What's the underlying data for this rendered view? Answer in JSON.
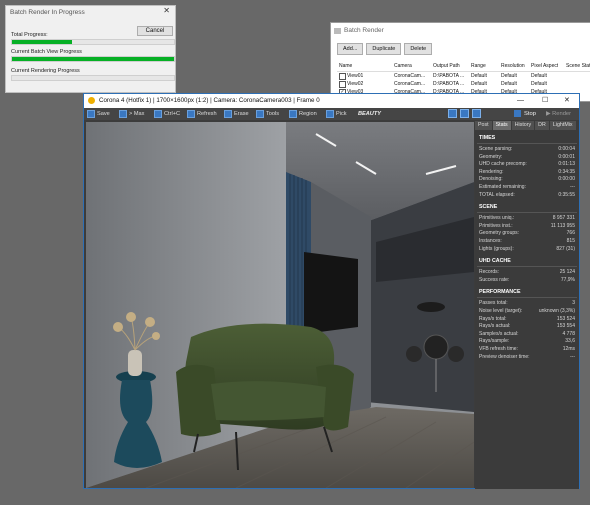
{
  "progress_window": {
    "title": "Batch Render In Progress",
    "cancel_label": "Cancel",
    "total_progress_label": "Total Progress:",
    "batch_view_label": "Current Batch View Progress",
    "rendering_label": "Current Rendering Progress",
    "total_progress": 0.37,
    "batch_view_progress": 1.0,
    "rendering_progress": 0.0,
    "bar_color": "#06b025"
  },
  "batch_window": {
    "title": "Batch Render",
    "buttons": [
      "Add...",
      "Duplicate",
      "Delete"
    ],
    "columns": [
      "Name",
      "Camera",
      "Output Path",
      "Range",
      "Resolution",
      "Pixel Aspect",
      "Scene State"
    ],
    "rows": [
      {
        "checked": false,
        "name": "View01",
        "camera": "CoronaCam...",
        "output": "D:\\PABOTA ...",
        "range": "Default",
        "resolution": "Default",
        "aspect": "Default"
      },
      {
        "checked": false,
        "name": "View02",
        "camera": "CoronaCam...",
        "output": "D:\\PABOTA ...",
        "range": "Default",
        "resolution": "Default",
        "aspect": "Default"
      },
      {
        "checked": true,
        "name": "View03",
        "camera": "CoronaCam...",
        "output": "D:\\PABOTA ...",
        "range": "Default",
        "resolution": "Default",
        "aspect": "Default"
      }
    ]
  },
  "vfb": {
    "title": "Corona 4 (Hotfix 1) | 1700×1600px (1:2) | Camera: CoronaCamera003 | Frame 0",
    "toolbar": {
      "save": "Save",
      "max": "> Max",
      "copy": "Ctrl+C",
      "refresh": "Refresh",
      "erase": "Erase",
      "tools": "Tools",
      "region": "Region",
      "pick": "Pick",
      "pass": "BEAUTY",
      "stop": "Stop",
      "render": "Render"
    },
    "tabs": [
      "Post",
      "Stats",
      "History",
      "DR",
      "LightMix"
    ],
    "active_tab": "Stats",
    "sections": [
      {
        "title": "TIMES",
        "rows": [
          [
            "Scene parsing:",
            "0:00:04"
          ],
          [
            "Geometry:",
            "0:00:01"
          ],
          [
            "UHD cache precomp:",
            "0:01:13"
          ],
          [
            "Rendering:",
            "0:34:35"
          ],
          [
            "Denoising:",
            "0:00:00"
          ],
          [
            "Estimated remaining:",
            "---"
          ],
          [
            "TOTAL elapsed:",
            "0:35:55"
          ]
        ]
      },
      {
        "title": "SCENE",
        "rows": [
          [
            "Primitives uniq.:",
            "8 957 331"
          ],
          [
            "Primitives inst.:",
            "11 113 955"
          ],
          [
            "Geometry groups:",
            "766"
          ],
          [
            "Instances:",
            "815"
          ],
          [
            "Lights (groups):",
            "827 (31)"
          ]
        ]
      },
      {
        "title": "UHD CACHE",
        "rows": [
          [
            "Records:",
            "25 124"
          ],
          [
            "Success rate:",
            "77,9%"
          ]
        ]
      },
      {
        "title": "PERFORMANCE",
        "rows": [
          [
            "Passes total:",
            "3"
          ],
          [
            "Noise level (target):",
            "unknown (3,3%)"
          ],
          [
            "Rays/s total:",
            "153 524"
          ],
          [
            "Rays/s actual:",
            "153 554"
          ],
          [
            "Samples/s actual:",
            "4 778"
          ],
          [
            "Rays/sample:",
            "33,6"
          ],
          [
            "VFB refresh time:",
            "12ms"
          ],
          [
            "Preview denoiser time:",
            "---"
          ]
        ]
      }
    ]
  },
  "colors": {
    "accent": "#3a78c2",
    "progress_green": "#06b025",
    "panel_bg": "#3b3b3b",
    "desktop_bg": "#686868"
  }
}
